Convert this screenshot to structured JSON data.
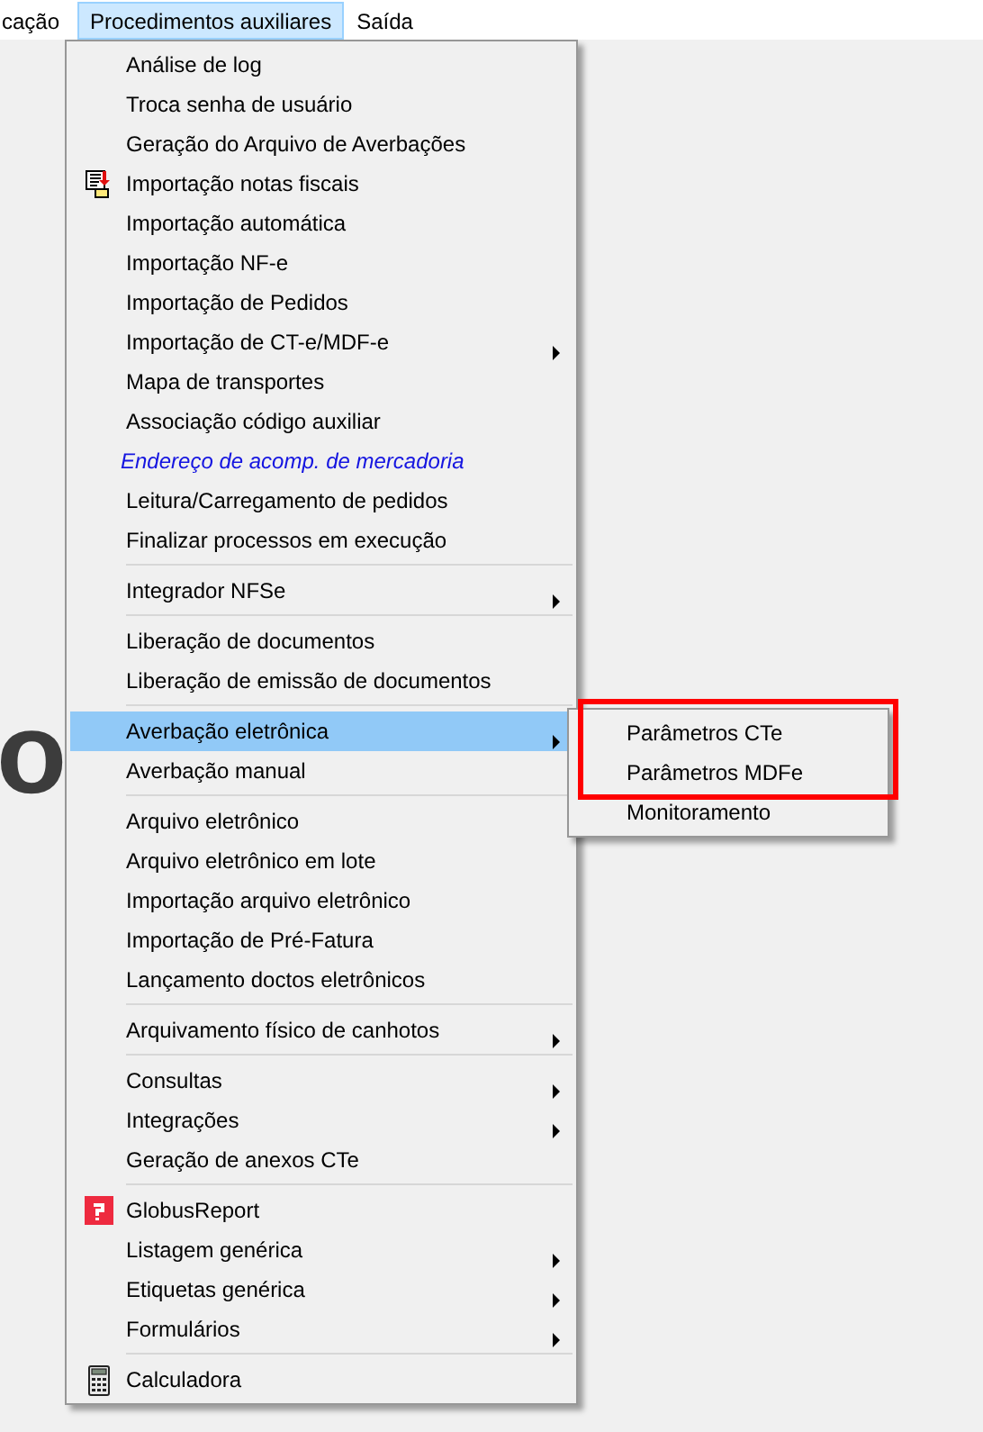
{
  "menu_bar": [
    {
      "label": "cação",
      "selected": false
    },
    {
      "label": "Procedimentos auxiliares",
      "selected": true
    },
    {
      "label": "Saída",
      "selected": false
    }
  ],
  "background_logo": {
    "text": "o"
  },
  "menu": {
    "items": [
      {
        "kind": "item",
        "label": "Análise de log"
      },
      {
        "kind": "item",
        "label": "Troca senha de usuário"
      },
      {
        "kind": "item",
        "label": "Geração do Arquivo de Averbações"
      },
      {
        "kind": "document",
        "label": "Importação notas fiscais"
      },
      {
        "kind": "item",
        "label": "Importação automática"
      },
      {
        "kind": "item",
        "label": "Importação NF-e"
      },
      {
        "kind": "item",
        "label": "Importação de Pedidos"
      },
      {
        "kind": "item",
        "label": "Importação de CT-e/MDF-e",
        "submenu_arrow": true
      },
      {
        "kind": "item",
        "label": "Mapa de transportes"
      },
      {
        "kind": "item",
        "label": "Associação código auxiliar"
      },
      {
        "kind": "link",
        "label": "Endereço de acomp. de mercadoria"
      },
      {
        "kind": "item",
        "label": "Leitura/Carregamento de pedidos"
      },
      {
        "kind": "item",
        "label": "Finalizar processos em execução"
      },
      {
        "kind": "separator"
      },
      {
        "kind": "item",
        "label": "Integrador NFSe",
        "submenu_arrow": true
      },
      {
        "kind": "separator"
      },
      {
        "kind": "item",
        "label": "Liberação de documentos"
      },
      {
        "kind": "item",
        "label": "Liberação de emissão de documentos"
      },
      {
        "kind": "separator"
      },
      {
        "kind": "item",
        "label": "Averbação eletrônica",
        "submenu_arrow": true,
        "selected": true,
        "submenu": [
          {
            "label": "Parâmetros CTe",
            "marked": true
          },
          {
            "label": "Parâmetros MDFe",
            "marked": true
          },
          {
            "label": "Monitoramento",
            "marked": false
          }
        ]
      },
      {
        "kind": "item",
        "label": "Averbação manual"
      },
      {
        "kind": "separator"
      },
      {
        "kind": "item",
        "label": "Arquivo eletrônico"
      },
      {
        "kind": "item",
        "label": "Arquivo eletrônico em lote"
      },
      {
        "kind": "item",
        "label": "Importação arquivo eletrônico"
      },
      {
        "kind": "item",
        "label": "Importação de Pré-Fatura"
      },
      {
        "kind": "item",
        "label": "Lançamento doctos eletrônicos"
      },
      {
        "kind": "separator"
      },
      {
        "kind": "item",
        "label": "Arquivamento físico de canhotos",
        "submenu_arrow": true
      },
      {
        "kind": "separator"
      },
      {
        "kind": "item",
        "label": "Consultas",
        "submenu_arrow": true
      },
      {
        "kind": "item",
        "label": "Integrações",
        "submenu_arrow": true
      },
      {
        "kind": "item",
        "label": "Geração de anexos CTe"
      },
      {
        "kind": "separator"
      },
      {
        "kind": "report",
        "label": "GlobusReport"
      },
      {
        "kind": "item",
        "label": "Listagem genérica",
        "submenu_arrow": true
      },
      {
        "kind": "item",
        "label": "Etiquetas genérica",
        "submenu_arrow": true
      },
      {
        "kind": "item",
        "label": "Formulários",
        "submenu_arrow": true
      },
      {
        "kind": "separator"
      },
      {
        "kind": "calculator",
        "label": "Calculadora"
      }
    ]
  }
}
